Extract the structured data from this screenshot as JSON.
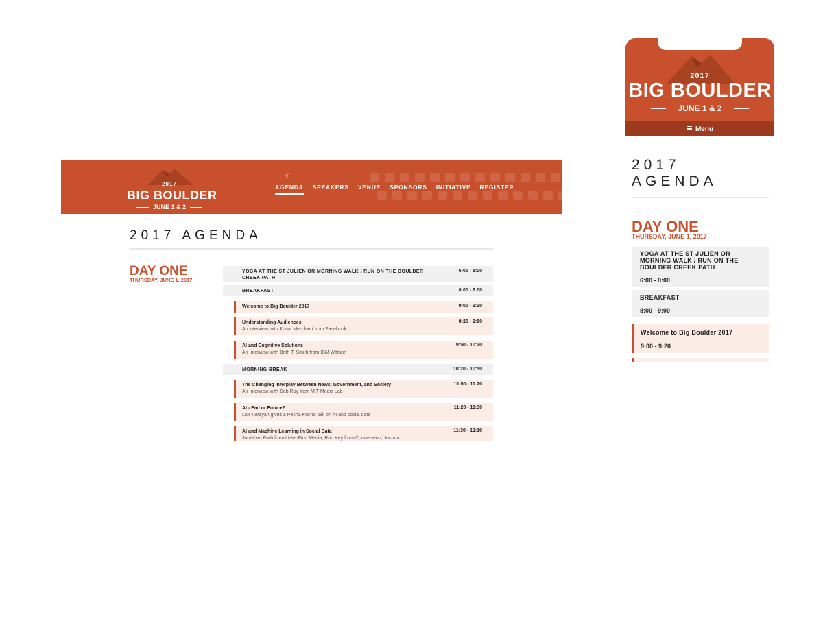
{
  "brand": {
    "year": "2017",
    "name": "BIG BOULDER",
    "dates": "JUNE 1 & 2",
    "color": "#c9502c"
  },
  "nav": {
    "items": [
      {
        "label": "AGENDA",
        "active": true
      },
      {
        "label": "SPEAKERS",
        "active": false
      },
      {
        "label": "VENUE",
        "active": false
      },
      {
        "label": "SPONSORS",
        "active": false
      },
      {
        "label": "INITIATIVE",
        "active": false
      },
      {
        "label": "REGISTER",
        "active": false
      }
    ]
  },
  "page": {
    "title": "2017 AGENDA",
    "title_line1": "2017",
    "title_line2": "AGENDA"
  },
  "day": {
    "title": "DAY ONE",
    "date": "THURSDAY, JUNE 1, 2017"
  },
  "schedule": [
    {
      "type": "general",
      "title": "YOGA AT THE ST JULIEN OR MORNING WALK / RUN ON THE BOULDER CREEK PATH",
      "subtitle": "",
      "time": "6:00 - 8:00"
    },
    {
      "type": "general",
      "title": "BREAKFAST",
      "subtitle": "",
      "time": "8:00 - 9:00"
    },
    {
      "type": "session",
      "title": "Welcome to Big Boulder 2017",
      "subtitle": "",
      "time": "9:00 - 9:20"
    },
    {
      "type": "session",
      "title": "Understanding Audiences",
      "subtitle": "An interview with Kunal Merchant from Facebook",
      "time": "9:20 - 9:50"
    },
    {
      "type": "session",
      "title": "AI and Cognitive Solutions",
      "subtitle": "An Interview with Beth T. Smith from IBM Watson",
      "time": "9:50 - 10:20"
    },
    {
      "type": "general",
      "title": "MORNING BREAK",
      "subtitle": "",
      "time": "10:20 - 10:50"
    },
    {
      "type": "session",
      "title": "The Changing Interplay Between News, Government, and Society",
      "subtitle": "An Interview with Deb Roy from MIT Media Lab",
      "time": "10:50 - 11:20"
    },
    {
      "type": "session",
      "title": "AI - Fad or Future?",
      "subtitle": "Lux Narayan gives a Pecha Kucha talk on AI and social data",
      "time": "11:20 - 11:30"
    },
    {
      "type": "session",
      "title": "AI and Machine Learning in Social Data",
      "subtitle": "Jonathan Farb from ListenFirst Media, Rob Key from Converseon, Joshua",
      "time": "11:30 - 12:10"
    }
  ],
  "mobile": {
    "menu_label": "Menu",
    "schedule": [
      {
        "type": "general",
        "title": "YOGA AT THE ST JULIEN OR MORNING WALK / RUN ON THE BOULDER CREEK PATH",
        "time": "6:00 - 8:00"
      },
      {
        "type": "general",
        "title": "BREAKFAST",
        "time": "8:00 - 9:00"
      },
      {
        "type": "session",
        "title": "Welcome to Big Boulder 2017",
        "time": "9:00 - 9:20"
      }
    ]
  },
  "icons": [
    "lightning-icon",
    "hamburger-icon",
    "mountain-icon"
  ]
}
